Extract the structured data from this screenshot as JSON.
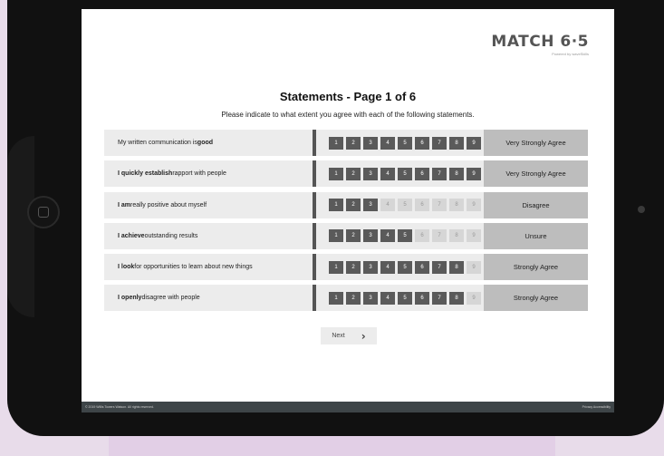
{
  "brand": {
    "logo": "MATCH 6·5",
    "tagline": "Powered by waveSkills"
  },
  "page": {
    "title": "Statements - Page 1 of 6",
    "instructions": "Please indicate to what extent you agree with each of the following statements."
  },
  "scale_numbers": [
    "1",
    "2",
    "3",
    "4",
    "5",
    "6",
    "7",
    "8",
    "9"
  ],
  "rows": [
    {
      "pre": "My written communication is ",
      "bold1": "good",
      "mid": "",
      "bold2": "",
      "post": "",
      "level": 9,
      "answer": "Very Strongly Agree"
    },
    {
      "pre": "",
      "bold1": "I quickly establish",
      "mid": " rapport with people",
      "bold2": "",
      "post": "",
      "level": 9,
      "answer": "Very Strongly Agree"
    },
    {
      "pre": "",
      "bold1": "I am",
      "mid": " really positive about myself",
      "bold2": "",
      "post": "",
      "level": 3,
      "answer": "Disagree"
    },
    {
      "pre": "",
      "bold1": "I achieve",
      "mid": " outstanding results",
      "bold2": "",
      "post": "",
      "level": 5,
      "answer": "Unsure"
    },
    {
      "pre": "",
      "bold1": "I look",
      "mid": " for opportunities to learn about new things",
      "bold2": "",
      "post": "",
      "level": 8,
      "answer": "Strongly Agree"
    },
    {
      "pre": "",
      "bold1": "I openly",
      "mid": " disagree with people",
      "bold2": "",
      "post": "",
      "level": 8,
      "answer": "Strongly Agree"
    }
  ],
  "nav": {
    "next_label": "Next"
  },
  "footer": {
    "copyright": "© 2019 Willis Towers Watson. All rights reserved.",
    "links": "Privacy Accessibility"
  },
  "colors": {
    "selected": "#5a5a5a",
    "unselected": "#d6d6d6",
    "answer_bg": "#bdbdbd",
    "footer": "#3e4548"
  }
}
